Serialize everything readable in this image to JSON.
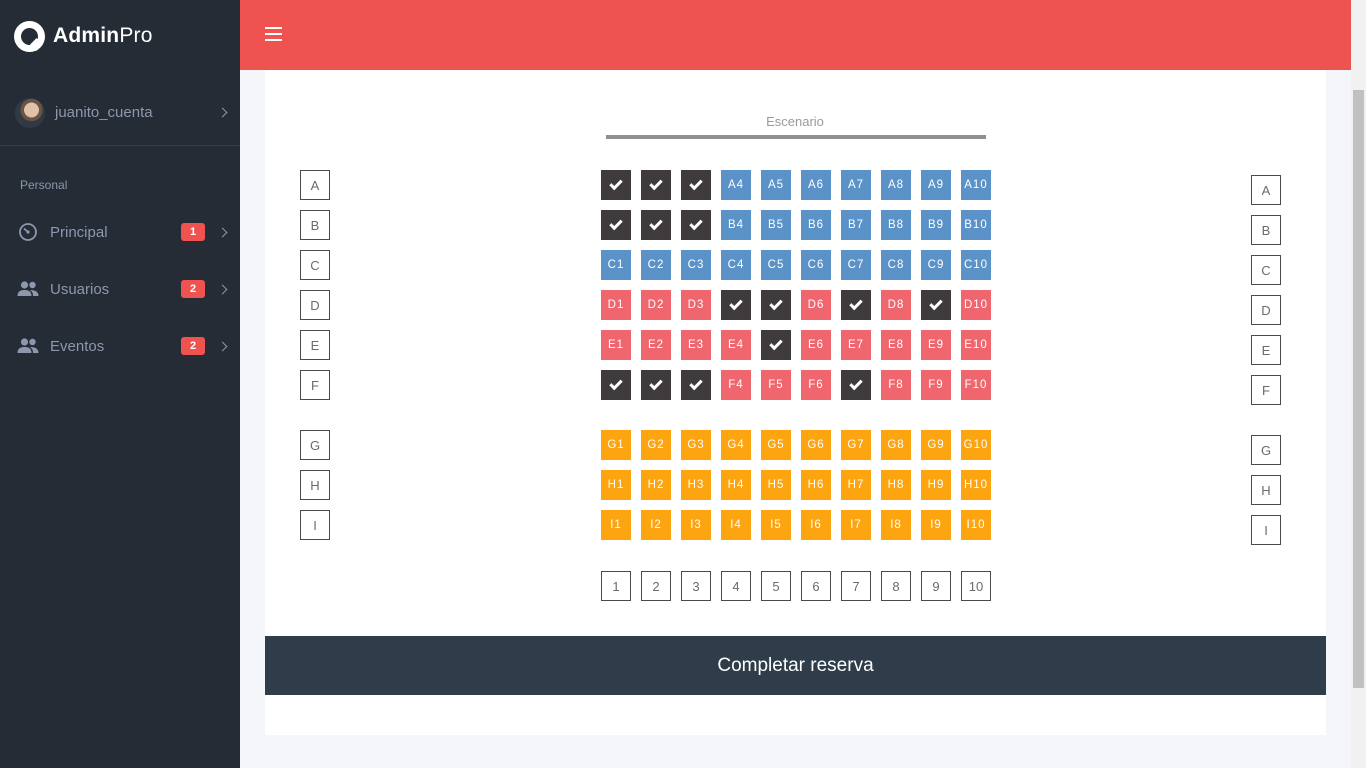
{
  "sidebar": {
    "logo": {
      "bold": "Admin",
      "light": "Pro"
    },
    "user": {
      "name": "juanito_cuenta"
    },
    "section_label": "Personal",
    "items": [
      {
        "label": "Principal",
        "badge": "1",
        "icon": "gauge-icon"
      },
      {
        "label": "Usuarios",
        "badge": "2",
        "icon": "users-icon"
      },
      {
        "label": "Eventos",
        "badge": "2",
        "icon": "users-icon"
      }
    ]
  },
  "colors": {
    "topbar": "#ef5350",
    "sidebar": "#252c36",
    "occupied": "#3f3a3b",
    "blue_zone": "#5b93c8",
    "pink_zone": "#f0666e",
    "orange_zone": "#fca510",
    "button": "#2f3d4a"
  },
  "seating": {
    "stage_label": "Escenario",
    "rows": [
      {
        "row": "A",
        "zone": "blue",
        "seats": [
          "occupied",
          "occupied",
          "occupied",
          "A4",
          "A5",
          "A6",
          "A7",
          "A8",
          "A9",
          "A10"
        ]
      },
      {
        "row": "B",
        "zone": "blue",
        "seats": [
          "occupied",
          "occupied",
          "occupied",
          "B4",
          "B5",
          "B6",
          "B7",
          "B8",
          "B9",
          "B10"
        ]
      },
      {
        "row": "C",
        "zone": "blue",
        "seats": [
          "C1",
          "C2",
          "C3",
          "C4",
          "C5",
          "C6",
          "C7",
          "C8",
          "C9",
          "C10"
        ]
      },
      {
        "row": "D",
        "zone": "pink",
        "seats": [
          "D1",
          "D2",
          "D3",
          "occupied",
          "occupied",
          "D6",
          "occupied",
          "D8",
          "occupied",
          "D10"
        ]
      },
      {
        "row": "E",
        "zone": "pink",
        "seats": [
          "E1",
          "E2",
          "E3",
          "E4",
          "occupied",
          "E6",
          "E7",
          "E8",
          "E9",
          "E10"
        ]
      },
      {
        "row": "F",
        "zone": "pink",
        "seats": [
          "occupied",
          "occupied",
          "occupied",
          "F4",
          "F5",
          "F6",
          "occupied",
          "F8",
          "F9",
          "F10"
        ]
      },
      {
        "row": "G",
        "zone": "orange",
        "seats": [
          "G1",
          "G2",
          "G3",
          "G4",
          "G5",
          "G6",
          "G7",
          "G8",
          "G9",
          "G10"
        ]
      },
      {
        "row": "H",
        "zone": "orange",
        "seats": [
          "H1",
          "H2",
          "H3",
          "H4",
          "H5",
          "H6",
          "H7",
          "H8",
          "H9",
          "H10"
        ]
      },
      {
        "row": "I",
        "zone": "orange",
        "seats": [
          "I1",
          "I2",
          "I3",
          "I4",
          "I5",
          "I6",
          "I7",
          "I8",
          "I9",
          "I10"
        ]
      }
    ],
    "columns": [
      "1",
      "2",
      "3",
      "4",
      "5",
      "6",
      "7",
      "8",
      "9",
      "10"
    ]
  },
  "actions": {
    "complete_label": "Completar reserva"
  }
}
